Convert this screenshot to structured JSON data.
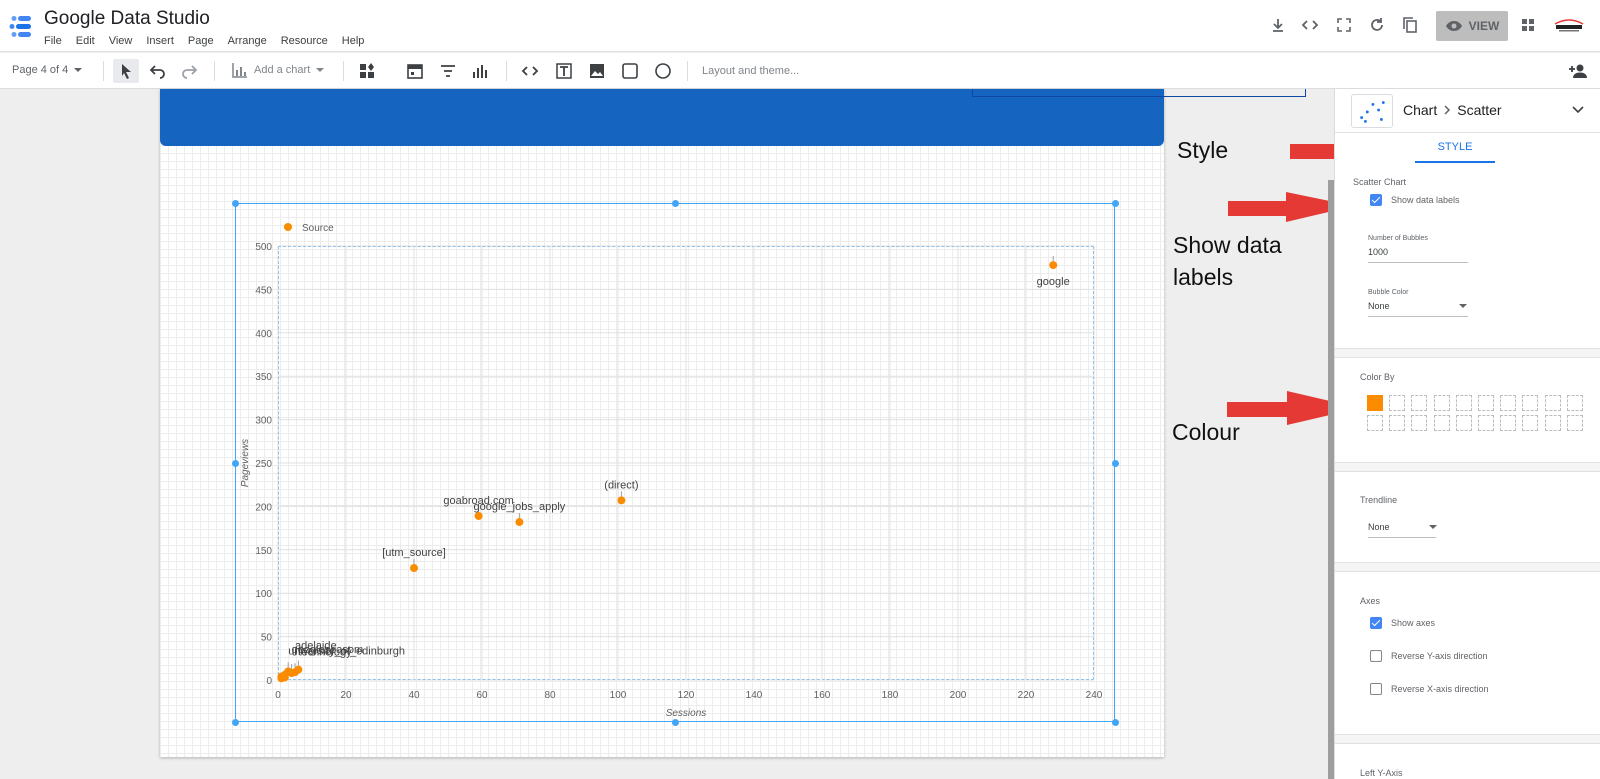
{
  "app": {
    "title": "Google Data Studio",
    "menu": [
      "File",
      "Edit",
      "View",
      "Insert",
      "Page",
      "Arrange",
      "Resource",
      "Help"
    ],
    "view_label": "VIEW"
  },
  "toolbar": {
    "page_selector": "Page 4 of 4",
    "add_chart": "Add a chart",
    "layout_theme": "Layout and theme..."
  },
  "panel": {
    "breadcrumb_chart": "Chart",
    "breadcrumb_type": "Scatter",
    "tab_style": "STYLE",
    "scatter_section": "Scatter Chart",
    "show_data_labels": "Show data labels",
    "show_data_labels_checked": true,
    "number_of_bubbles_label": "Number of Bubbles",
    "number_of_bubbles": "1000",
    "bubble_color_label": "Bubble Color",
    "bubble_color": "None",
    "color_by_label": "Color By",
    "selected_color": "#fb8c00",
    "trendline_label": "Trendline",
    "trendline": "None",
    "axes_label": "Axes",
    "show_axes": "Show axes",
    "show_axes_checked": true,
    "reverse_y": "Reverse Y-axis direction",
    "reverse_x": "Reverse X-axis direction",
    "left_y_axis": "Left Y-Axis"
  },
  "annotations": {
    "style": "Style",
    "show_data_labels_1": "Show data",
    "show_data_labels_2": "labels",
    "colour": "Colour"
  },
  "chart_data": {
    "type": "scatter",
    "legend": "Source",
    "legend_position": "top-left",
    "xlabel": "Sessions",
    "ylabel": "Pageviews",
    "xlim": [
      0,
      240
    ],
    "ylim": [
      0,
      500
    ],
    "x_ticks": [
      0,
      20,
      40,
      60,
      80,
      100,
      120,
      140,
      160,
      180,
      200,
      220,
      240
    ],
    "y_ticks": [
      0,
      50,
      100,
      150,
      200,
      250,
      300,
      350,
      400,
      450,
      500
    ],
    "grid": true,
    "color": "#fb8c00",
    "points": [
      {
        "label": "google",
        "x": 228,
        "y": 478
      },
      {
        "label": "(direct)",
        "x": 101,
        "y": 207
      },
      {
        "label": "goabroad.com",
        "x": 59,
        "y": 189
      },
      {
        "label": "google_jobs_apply",
        "x": 71,
        "y": 182
      },
      {
        "label": "[utm_source]",
        "x": 40,
        "y": 129
      },
      {
        "label": "university_of_edinburgh",
        "x": 3,
        "y": 10
      },
      {
        "label": "googleseasom",
        "x": 4,
        "y": 8
      },
      {
        "label": "adelaide",
        "x": 5,
        "y": 9
      },
      {
        "label": "technology",
        "x": 6,
        "y": 12
      },
      {
        "label": "",
        "x": 1,
        "y": 4
      },
      {
        "label": "",
        "x": 2,
        "y": 6
      },
      {
        "label": "",
        "x": 1,
        "y": 2
      },
      {
        "label": "",
        "x": 2,
        "y": 3
      }
    ]
  }
}
